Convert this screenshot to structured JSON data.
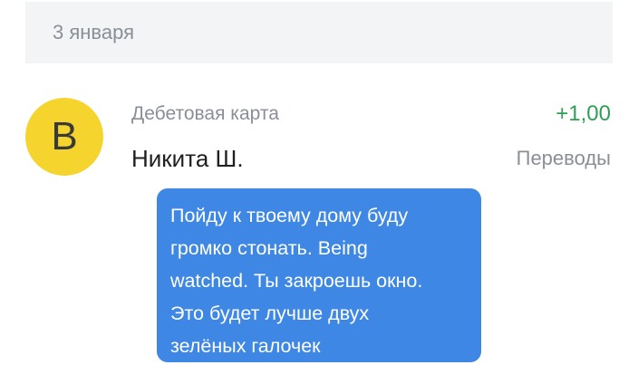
{
  "header": {
    "date": "3 января"
  },
  "transaction": {
    "avatar_letter": "В",
    "account": "Дебетовая карта",
    "amount": "+1,00",
    "name": "Никита Ш.",
    "category": "Переводы",
    "message_lines": [
      "Пойду к твоему дому буду",
      "громко стонать. Being",
      "watched. Ты закроешь окно.",
      "Это будет лучше двух",
      "зелёных галочек"
    ]
  },
  "colors": {
    "avatar_bg": "#f6d42e",
    "amount_positive": "#2ea055",
    "bubble_bg": "#3e87e4",
    "secondary_text": "#8a8f97"
  }
}
